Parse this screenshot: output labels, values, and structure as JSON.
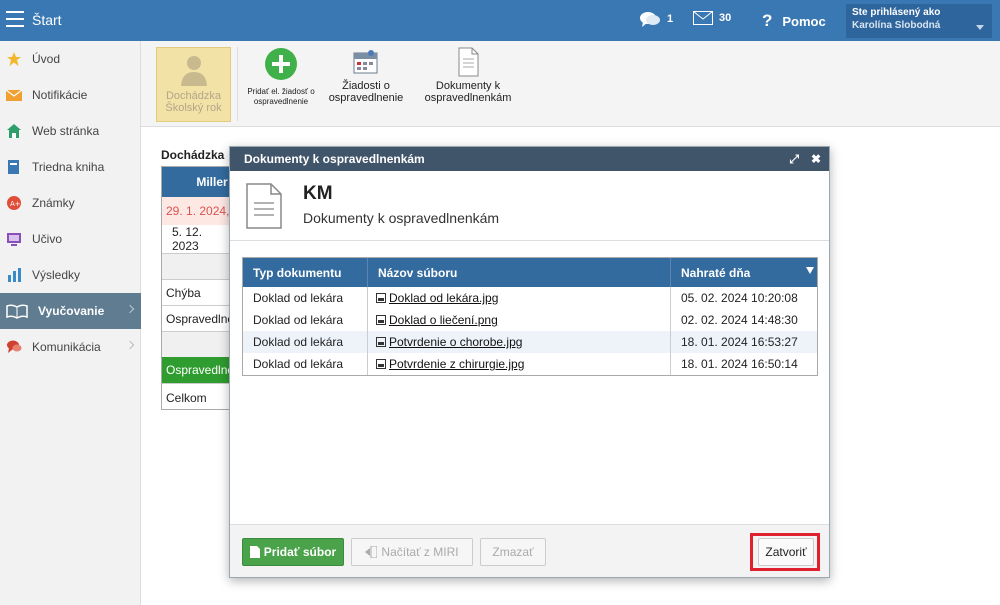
{
  "topbar": {
    "title": "Štart",
    "chat_count": "1",
    "mail_count": "30",
    "help_label": "Pomoc",
    "user_caption": "Ste prihlásený ako",
    "user_name": "Karolína Slobodná"
  },
  "sidebar": {
    "items": [
      {
        "label": "Úvod",
        "icon": "star-icon",
        "color": "#f1b82d"
      },
      {
        "label": "Notifikácie",
        "icon": "envelope-icon",
        "color": "#f0a030"
      },
      {
        "label": "Web stránka",
        "icon": "home-icon",
        "color": "#2e9e6a"
      },
      {
        "label": "Triedna kniha",
        "icon": "book-icon",
        "color": "#3a78b4"
      },
      {
        "label": "Známky",
        "icon": "grade-icon",
        "color": "#e04e3a"
      },
      {
        "label": "Učivo",
        "icon": "monitor-icon",
        "color": "#8a4fb8"
      },
      {
        "label": "Výsledky",
        "icon": "bar-chart-icon",
        "color": "#3a8cc8"
      },
      {
        "label": "Vyučovanie",
        "icon": "open-book-icon",
        "color": "#ffffff"
      },
      {
        "label": "Komunikácia",
        "icon": "speech-icon",
        "color": "#d04030"
      }
    ]
  },
  "toolbar": {
    "dochadzka_label": "Dochádzka Školský rok",
    "add_request_label": "Pridať el. žiadosť o ospravedlnenie",
    "requests_label": "Žiadosti o ospravedlnenie",
    "documents_label": "Dokumenty k ospravedlnenkám"
  },
  "background": {
    "title": "Dochádzka",
    "table_header": "Miller",
    "rows": [
      "29. 1. 2024,",
      "5. 12. 2023",
      "",
      "Chýba",
      "Ospravedlne",
      "",
      "Ospravedlne",
      "Celkom"
    ]
  },
  "modal": {
    "title": "Dokumenty k ospravedlnenkám",
    "student_initials": "KM",
    "subtitle": "Dokumenty k ospravedlnenkám",
    "columns": [
      "Typ dokumentu",
      "Názov súboru",
      "Nahraté dňa"
    ],
    "rows": [
      {
        "type": "Doklad od lekára",
        "file": "Doklad od lekára.jpg",
        "uploaded": "05. 02. 2024 10:20:08"
      },
      {
        "type": "Doklad od lekára",
        "file": "Doklad o liečení.png",
        "uploaded": "02. 02. 2024 14:48:30"
      },
      {
        "type": "Doklad od lekára",
        "file": "Potvrdenie o chorobe.jpg",
        "uploaded": "18. 01. 2024 16:53:27"
      },
      {
        "type": "Doklad od lekára",
        "file": "Potvrdenie z chirurgie.jpg",
        "uploaded": "18. 01. 2024 16:50:14"
      }
    ],
    "add_file_label": "Pridať súbor",
    "load_miri_label": "Načítať z MIRI",
    "delete_label": "Zmazať",
    "close_label": "Zatvoriť"
  }
}
